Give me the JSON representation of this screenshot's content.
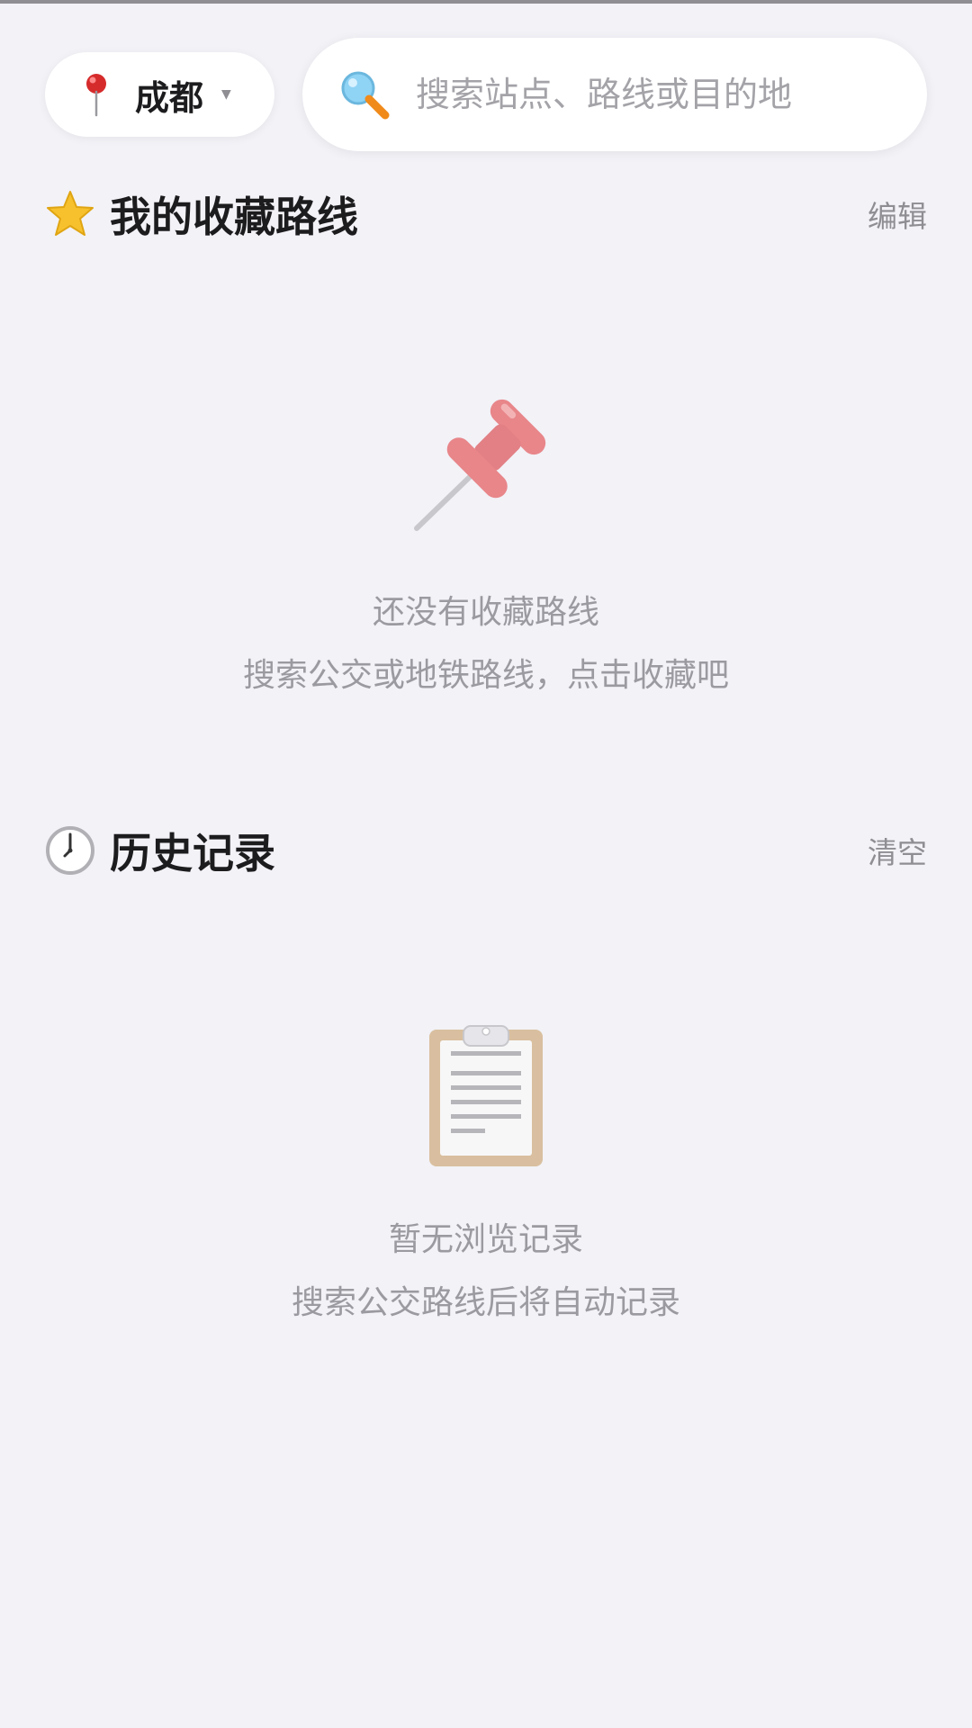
{
  "header": {
    "city": "成都",
    "search_placeholder": "搜索站点、路线或目的地"
  },
  "favorites": {
    "title": "我的收藏路线",
    "action": "编辑",
    "empty_title": "还没有收藏路线",
    "empty_hint": "搜索公交或地铁路线，点击收藏吧"
  },
  "history": {
    "title": "历史记录",
    "action": "清空",
    "empty_title": "暂无浏览记录",
    "empty_hint": "搜索公交路线后将自动记录"
  },
  "colors": {
    "background": "#f2f2f7",
    "text_primary": "#1c1c1e",
    "text_secondary": "#9a9aa0",
    "pin_red": "#e8868a",
    "star_yellow": "#f7c12e"
  },
  "icons": [
    "location-pin-icon",
    "search-icon",
    "star-icon",
    "pushpin-icon",
    "clock-icon",
    "clipboard-icon"
  ]
}
